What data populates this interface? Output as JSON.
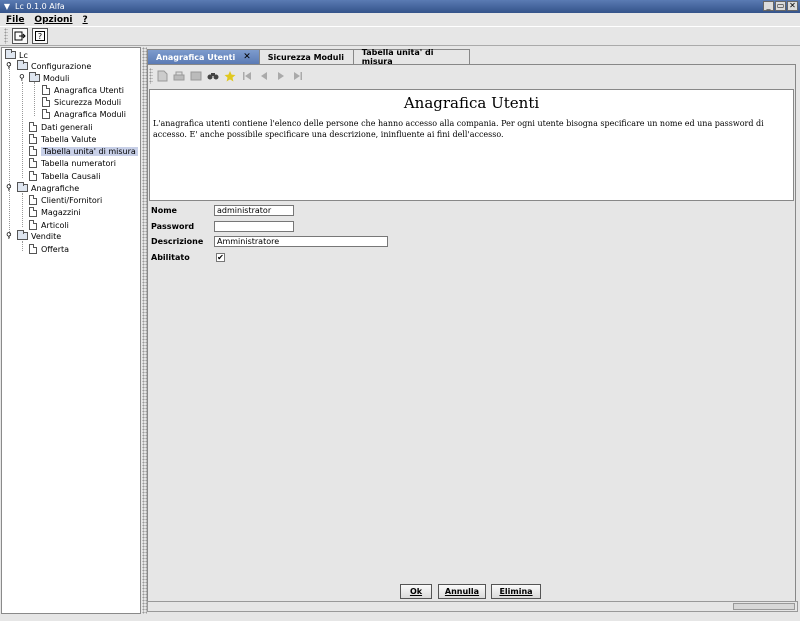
{
  "window": {
    "title": "Lc 0.1.0 Alfa",
    "btn_min": "_",
    "btn_max": "▭",
    "btn_close": "✕"
  },
  "menu": {
    "file": "File",
    "opzioni": "Opzioni",
    "help": "?"
  },
  "toolbar": {
    "exit_icon": "exit-icon",
    "help_icon": "help-icon"
  },
  "tree": {
    "root": "Lc",
    "configurazione": "Configurazione",
    "moduli": "Moduli",
    "anagrafica_utenti": "Anagrafica Utenti",
    "sicurezza_moduli": "Sicurezza Moduli",
    "anagrafica_moduli": "Anagrafica Moduli",
    "dati_generali": "Dati generali",
    "tabella_valute": "Tabella Valute",
    "tabella_unita": "Tabella unita' di misura",
    "tabella_numeratori": "Tabella numeratori",
    "tabella_causali": "Tabella Causali",
    "anagrafiche": "Anagrafiche",
    "clienti_fornitori": "Clienti/Fornitori",
    "magazzini": "Magazzini",
    "articoli": "Articoli",
    "vendite": "Vendite",
    "offerta": "Offerta"
  },
  "tabs": [
    {
      "label": "Anagrafica Utenti",
      "close": "✕"
    },
    {
      "label": "Sicurezza Moduli"
    },
    {
      "label": "Tabella unita' di misura"
    }
  ],
  "nav_toolbar": {
    "icons": [
      "new-icon",
      "print-icon",
      "list-icon",
      "find-icon",
      "star-icon",
      "first-icon",
      "prev-icon",
      "next-icon",
      "last-icon"
    ]
  },
  "panel": {
    "title": "Anagrafica Utenti",
    "description": "L'anagrafica utenti contiene l'elenco delle persone che hanno accesso alla compania. Per ogni utente bisogna specificare un nome ed una password di accesso. E' anche possibile specificare una descrizione, ininfluente ai fini dell'accesso."
  },
  "form": {
    "nome_label": "Nome",
    "nome_value": "administrator",
    "password_label": "Password",
    "password_value": "",
    "descrizione_label": "Descrizione",
    "descrizione_value": "Amministratore",
    "abilitato_label": "Abilitato",
    "abilitato_mark": "✔"
  },
  "buttons": {
    "ok": "Ok",
    "annulla": "Annulla",
    "elimina": "Elimina"
  }
}
